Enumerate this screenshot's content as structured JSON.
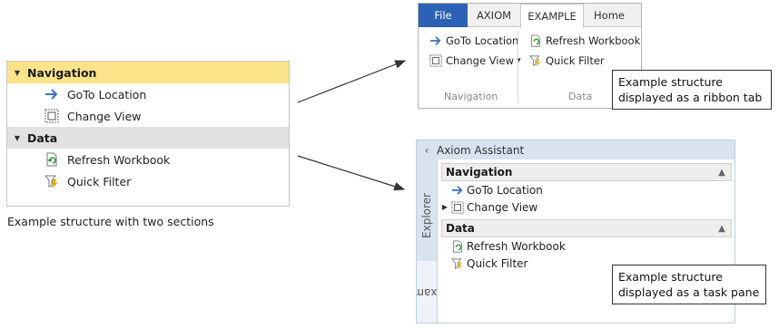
{
  "structure": {
    "sections": [
      {
        "label": "Navigation",
        "items": [
          {
            "label": "GoTo Location",
            "icon": "arrow-right-icon"
          },
          {
            "label": "Change View",
            "icon": "change-view-icon"
          }
        ]
      },
      {
        "label": "Data",
        "items": [
          {
            "label": "Refresh Workbook",
            "icon": "refresh-workbook-icon"
          },
          {
            "label": "Quick Filter",
            "icon": "quick-filter-icon"
          }
        ]
      }
    ],
    "caption": "Example structure with two sections"
  },
  "ribbon": {
    "tabs": [
      "File",
      "AXIOM",
      "EXAMPLE",
      "Home"
    ],
    "nav_items": [
      "GoTo Location",
      "Change View"
    ],
    "data_items": [
      "Refresh Workbook",
      "Quick Filter"
    ],
    "dropdown_glyph": "▾",
    "group_navigation": "Navigation",
    "group_data": "Data",
    "callout_line1": "Example structure",
    "callout_line2": "displayed as a ribbon tab"
  },
  "task_pane": {
    "title": "Axiom Assistant",
    "collapse_glyph": "‹",
    "side_tabs": [
      "Explorer",
      "Example"
    ],
    "close_glyph": "×",
    "sections": [
      {
        "label": "Navigation",
        "items": [
          "GoTo Location",
          "Change View"
        ]
      },
      {
        "label": "Data",
        "items": [
          "Refresh Workbook",
          "Quick Filter"
        ]
      }
    ],
    "callout_line1": "Example structure",
    "callout_line2": "displayed as a task pane"
  },
  "colors": {
    "nav_header": "#fbe38a",
    "data_header": "#e2e2e2",
    "file_tab": "#2b62b4",
    "pane_bg": "#d8e3ef",
    "icon_blue": "#3a6fc4",
    "icon_yellow": "#e8b40a"
  }
}
